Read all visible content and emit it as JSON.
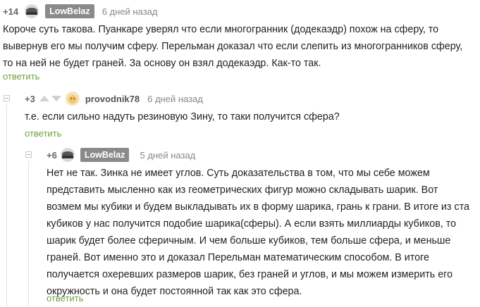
{
  "comments": [
    {
      "score": "+14",
      "author": "LowBelaz",
      "time": "6 дней назад",
      "text": "Короче суть такова. Пуанкаре уверял что если многогранник (додекаэдр) похож на сферу, то вывернув его мы получим сферу. Перельман доказал что если слепить из многогранников сферу, то на ней не будет граней. За основу он взял додекаэдр. Как-то так.",
      "reply": "ответить"
    },
    {
      "score": "+3",
      "author": "provodnik78",
      "time": "6 дней назад",
      "text": "т.е. если сильно надуть резиновую Зину, то таки получится сфера?",
      "reply": "ответить"
    },
    {
      "score": "+6",
      "author": "LowBelaz",
      "time": "5 дней назад",
      "text": "Нет не так. Зинка не имеет углов. Суть доказательства в том, что мы себе можем представить мысленно как из геометрических фигур можно складывать шарик. Вот возмем мы кубики и будем выкладывать их в форму шарика, грань к грани. В итоге из ста кубиков у нас получится подобие шарика(сферы). А если взять миллиарды кубиков, то шарик будет более сферичным. И чем больше кубиков, тем больше сфера, и меньше граней. Вот именно это и доказал Перельман математическим способом. В итоге получается охеревших размеров шарик, без граней и углов, и мы можем измерить его окружность и она будет постоянной так как это сфера.",
      "reply": "ответить"
    }
  ]
}
